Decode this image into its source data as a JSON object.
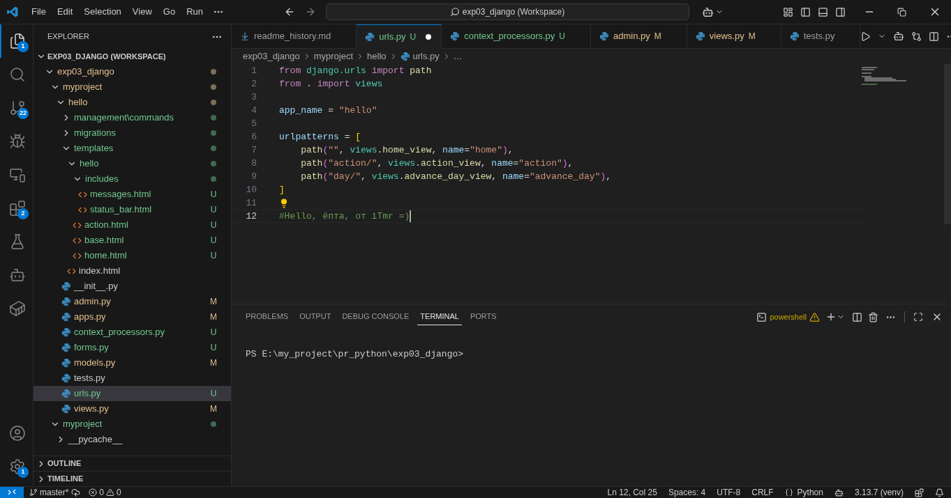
{
  "title_bar": {
    "menu": [
      "File",
      "Edit",
      "Selection",
      "View",
      "Go",
      "Run"
    ],
    "command_center": "exp03_django (Workspace)"
  },
  "activity_bar": {
    "items": [
      {
        "kind": "explorer",
        "selected": true,
        "badge": "1"
      },
      {
        "kind": "search",
        "selected": false
      },
      {
        "kind": "source_control",
        "selected": false,
        "badge": "22"
      },
      {
        "kind": "run_debug",
        "selected": false
      },
      {
        "kind": "remote",
        "selected": false
      },
      {
        "kind": "extensions",
        "selected": false,
        "badge": "2"
      },
      {
        "kind": "testing",
        "selected": false
      },
      {
        "kind": "copilot",
        "selected": false
      },
      {
        "kind": "containers",
        "selected": false
      },
      {
        "kind": "accounts",
        "selected": false
      },
      {
        "kind": "settings",
        "selected": false,
        "badge": "1"
      }
    ]
  },
  "sidebar": {
    "title": "EXPLORER",
    "workspace": "EXP03_DJANGO (WORKSPACE)",
    "tree": [
      {
        "name": "exp03_django",
        "kind": "folder",
        "expanded": true,
        "modified": true,
        "untracked": false,
        "dot": true,
        "selected": false,
        "children": [
          {
            "name": "myproject",
            "kind": "folder",
            "expanded": true,
            "modified": true,
            "untracked": false,
            "dot": true,
            "selected": false,
            "children": [
              {
                "name": "hello",
                "kind": "folder",
                "expanded": true,
                "modified": true,
                "untracked": false,
                "dot": true,
                "selected": false,
                "children": [
                  {
                    "name": "management\\commands",
                    "kind": "folder",
                    "expanded": false,
                    "modified": false,
                    "untracked": true,
                    "dot": true,
                    "selected": false
                  },
                  {
                    "name": "migrations",
                    "kind": "folder",
                    "expanded": false,
                    "modified": false,
                    "untracked": true,
                    "dot": true,
                    "selected": false
                  },
                  {
                    "name": "templates",
                    "kind": "folder",
                    "expanded": true,
                    "modified": false,
                    "untracked": true,
                    "dot": true,
                    "selected": false,
                    "children": [
                      {
                        "name": "hello",
                        "kind": "folder",
                        "expanded": true,
                        "modified": false,
                        "untracked": true,
                        "dot": true,
                        "selected": false,
                        "children": [
                          {
                            "name": "includes",
                            "kind": "folder",
                            "expanded": true,
                            "modified": false,
                            "untracked": true,
                            "dot": true,
                            "selected": false,
                            "children": [
                              {
                                "name": "messages.html",
                                "kind": "html",
                                "modified": false,
                                "untracked": true,
                                "badge": "U",
                                "selected": false
                              },
                              {
                                "name": "status_bar.html",
                                "kind": "html",
                                "modified": false,
                                "untracked": true,
                                "badge": "U",
                                "selected": false
                              }
                            ]
                          },
                          {
                            "name": "action.html",
                            "kind": "html",
                            "modified": false,
                            "untracked": true,
                            "badge": "U",
                            "selected": false
                          },
                          {
                            "name": "base.html",
                            "kind": "html",
                            "modified": false,
                            "untracked": true,
                            "badge": "U",
                            "selected": false
                          },
                          {
                            "name": "home.html",
                            "kind": "html",
                            "modified": false,
                            "untracked": true,
                            "badge": "U",
                            "selected": false
                          }
                        ]
                      },
                      {
                        "name": "index.html",
                        "kind": "html",
                        "modified": false,
                        "untracked": false,
                        "selected": false
                      }
                    ]
                  },
                  {
                    "name": "__init__.py",
                    "kind": "python",
                    "modified": false,
                    "untracked": false,
                    "selected": false
                  },
                  {
                    "name": "admin.py",
                    "kind": "python",
                    "modified": true,
                    "untracked": false,
                    "badge": "M",
                    "selected": false
                  },
                  {
                    "name": "apps.py",
                    "kind": "python",
                    "modified": true,
                    "untracked": false,
                    "badge": "M",
                    "selected": false
                  },
                  {
                    "name": "context_processors.py",
                    "kind": "python",
                    "modified": false,
                    "untracked": true,
                    "badge": "U",
                    "selected": false
                  },
                  {
                    "name": "forms.py",
                    "kind": "python",
                    "modified": false,
                    "untracked": true,
                    "badge": "U",
                    "selected": false
                  },
                  {
                    "name": "models.py",
                    "kind": "python",
                    "modified": true,
                    "untracked": false,
                    "badge": "M",
                    "selected": false
                  },
                  {
                    "name": "tests.py",
                    "kind": "python",
                    "modified": false,
                    "untracked": false,
                    "selected": false
                  },
                  {
                    "name": "urls.py",
                    "kind": "python",
                    "modified": false,
                    "untracked": true,
                    "badge": "U",
                    "selected": true
                  },
                  {
                    "name": "views.py",
                    "kind": "python",
                    "modified": true,
                    "untracked": false,
                    "badge": "M",
                    "selected": false
                  }
                ]
              }
            ]
          },
          {
            "name": "myproject",
            "kind": "folder",
            "expanded": true,
            "modified": false,
            "untracked": true,
            "dot": true,
            "selected": false,
            "children": [
              {
                "name": "__pycache__",
                "kind": "folder",
                "expanded": false,
                "modified": false,
                "untracked": false,
                "selected": false
              }
            ]
          }
        ]
      }
    ],
    "sections": [
      {
        "title": "OUTLINE",
        "expanded": false
      },
      {
        "title": "TIMELINE",
        "expanded": false
      }
    ]
  },
  "tabs": [
    {
      "label": "readme_history.md",
      "kind": "markdown",
      "modified": false,
      "untracked": false,
      "selected": false,
      "dirty": false
    },
    {
      "label": "urls.py",
      "kind": "python",
      "modified": false,
      "untracked": true,
      "badge": "U",
      "selected": true,
      "dirty": true
    },
    {
      "label": "context_processors.py",
      "kind": "python",
      "modified": false,
      "untracked": true,
      "badge": "U",
      "selected": false,
      "dirty": false
    },
    {
      "label": "admin.py",
      "kind": "python",
      "modified": true,
      "untracked": false,
      "badge": "M",
      "selected": false,
      "dirty": false
    },
    {
      "label": "views.py",
      "kind": "python",
      "modified": true,
      "untracked": false,
      "badge": "M",
      "selected": false,
      "dirty": false
    },
    {
      "label": "tests.py",
      "kind": "python",
      "modified": false,
      "untracked": false,
      "selected": false,
      "dirty": false
    }
  ],
  "breadcrumbs": [
    "exp03_django",
    "myproject",
    "hello",
    "urls.py",
    "…"
  ],
  "editor": {
    "lines": [
      {
        "number": "1",
        "current": false,
        "tokens": [
          {
            "kind": "keyword",
            "text": "from "
          },
          {
            "kind": "module",
            "text": "django.urls "
          },
          {
            "kind": "keyword",
            "text": "import "
          },
          {
            "kind": "func",
            "text": "path"
          }
        ]
      },
      {
        "number": "2",
        "current": false,
        "tokens": [
          {
            "kind": "keyword",
            "text": "from "
          },
          {
            "kind": "plain",
            "text": ". "
          },
          {
            "kind": "keyword",
            "text": "import "
          },
          {
            "kind": "module",
            "text": "views"
          }
        ]
      },
      {
        "number": "3",
        "current": false
      },
      {
        "number": "4",
        "current": false,
        "tokens": [
          {
            "kind": "var",
            "text": "app_name"
          },
          {
            "kind": "plain",
            "text": " = "
          },
          {
            "kind": "string",
            "text": "\"hello\""
          }
        ]
      },
      {
        "number": "5",
        "current": false
      },
      {
        "number": "6",
        "current": false,
        "tokens": [
          {
            "kind": "var",
            "text": "urlpatterns"
          },
          {
            "kind": "plain",
            "text": " = "
          },
          {
            "kind": "bracket",
            "text": "["
          }
        ]
      },
      {
        "number": "7",
        "current": false,
        "tokens": [
          {
            "kind": "func",
            "text": "    path"
          },
          {
            "kind": "paren",
            "text": "("
          },
          {
            "kind": "string",
            "text": "\"\""
          },
          {
            "kind": "plain",
            "text": ", "
          },
          {
            "kind": "module",
            "text": "views"
          },
          {
            "kind": "plain",
            "text": "."
          },
          {
            "kind": "func",
            "text": "home_view"
          },
          {
            "kind": "plain",
            "text": ", "
          },
          {
            "kind": "var",
            "text": "name"
          },
          {
            "kind": "plain",
            "text": "="
          },
          {
            "kind": "string",
            "text": "\"home\""
          },
          {
            "kind": "paren",
            "text": ")"
          },
          {
            "kind": "plain",
            "text": ","
          }
        ]
      },
      {
        "number": "8",
        "current": false,
        "tokens": [
          {
            "kind": "func",
            "text": "    path"
          },
          {
            "kind": "paren",
            "text": "("
          },
          {
            "kind": "string",
            "text": "\"action/\""
          },
          {
            "kind": "plain",
            "text": ", "
          },
          {
            "kind": "module",
            "text": "views"
          },
          {
            "kind": "plain",
            "text": "."
          },
          {
            "kind": "func",
            "text": "action_view"
          },
          {
            "kind": "plain",
            "text": ", "
          },
          {
            "kind": "var",
            "text": "name"
          },
          {
            "kind": "plain",
            "text": "="
          },
          {
            "kind": "string",
            "text": "\"action\""
          },
          {
            "kind": "paren",
            "text": ")"
          },
          {
            "kind": "plain",
            "text": ","
          }
        ]
      },
      {
        "number": "9",
        "current": false,
        "tokens": [
          {
            "kind": "func",
            "text": "    path"
          },
          {
            "kind": "paren",
            "text": "("
          },
          {
            "kind": "string",
            "text": "\"day/\""
          },
          {
            "kind": "plain",
            "text": ", "
          },
          {
            "kind": "module",
            "text": "views"
          },
          {
            "kind": "plain",
            "text": "."
          },
          {
            "kind": "func",
            "text": "advance_day_view"
          },
          {
            "kind": "plain",
            "text": ", "
          },
          {
            "kind": "var",
            "text": "name"
          },
          {
            "kind": "plain",
            "text": "="
          },
          {
            "kind": "string",
            "text": "\"advance_day\""
          },
          {
            "kind": "paren",
            "text": ")"
          },
          {
            "kind": "plain",
            "text": ","
          }
        ]
      },
      {
        "number": "10",
        "current": false,
        "tokens": [
          {
            "kind": "bracket",
            "text": "]"
          }
        ]
      },
      {
        "number": "11",
        "current": false,
        "lightbulb": true
      },
      {
        "number": "12",
        "current": true,
        "tokens": [
          {
            "kind": "comment",
            "text": "#Hello, ёпта, от iTmr =)"
          }
        ]
      }
    ]
  },
  "panel": {
    "tabs": [
      {
        "label": "PROBLEMS",
        "selected": false
      },
      {
        "label": "OUTPUT",
        "selected": false
      },
      {
        "label": "DEBUG CONSOLE",
        "selected": false
      },
      {
        "label": "TERMINAL",
        "selected": true
      },
      {
        "label": "PORTS",
        "selected": false
      }
    ],
    "terminal_name": "powershell",
    "terminal_text": "PS E:\\my_project\\pr_python\\exp03_django>"
  },
  "status_bar": {
    "branch": "master*",
    "errors": "0",
    "warnings": "0",
    "position": "Ln 12, Col 25",
    "indent": "Spaces: 4",
    "encoding": "UTF-8",
    "eol": "CRLF",
    "language": "Python",
    "interpreter": "3.13.7 (venv)"
  }
}
